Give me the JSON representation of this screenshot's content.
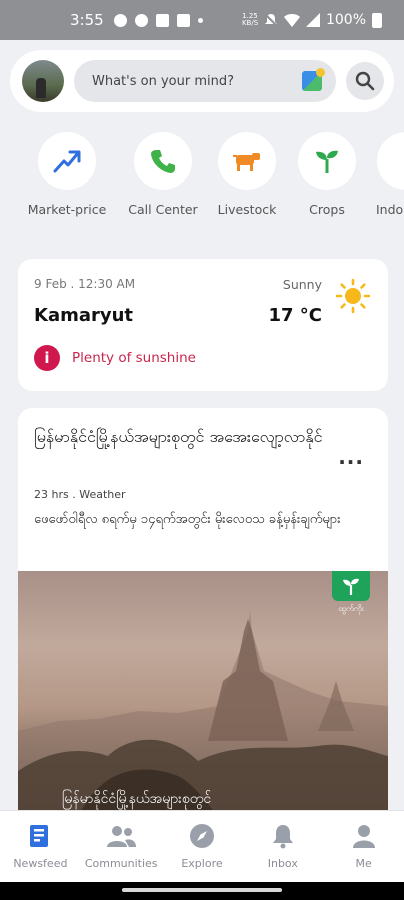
{
  "status_bar": {
    "time": "3:55",
    "network_speed": "1.25 KB/S",
    "battery": "100%"
  },
  "composer": {
    "placeholder": "What's on your mind?"
  },
  "categories": [
    {
      "label": "Market-price",
      "icon": "trend-up-icon"
    },
    {
      "label": "Call Center",
      "icon": "phone-icon"
    },
    {
      "label": "Livestock",
      "icon": "cow-icon"
    },
    {
      "label": "Crops",
      "icon": "sprout-icon"
    },
    {
      "label": "Indo",
      "icon": "indoor-icon"
    }
  ],
  "weather": {
    "date_time": "9 Feb . 12:30 AM",
    "condition": "Sunny",
    "location": "Kamaryut",
    "temperature": "17 °C",
    "alert": "Plenty of sunshine",
    "alert_color": "#c8264c"
  },
  "post": {
    "title": "မြန်မာနိုင်ငံမြို့နယ်အများစုတွင် အအေးလျော့လာနိုင်",
    "time": "23 hrs",
    "category": "Weather",
    "excerpt": "ဖေဖော်ဝါရီလ ၈ရက်မှ ၁၄ရက်အတွင်း မိုးလေဝသ ခန့်မှန်းချက်များ",
    "image_caption": "မြန်မာနိုင်ငံမြို့နယ်အများစုတွင်",
    "logo_text": "ထွက်ကိုး"
  },
  "bottom_nav": [
    {
      "label": "Newsfeed",
      "icon": "newsfeed-icon",
      "active": true
    },
    {
      "label": "Communities",
      "icon": "communities-icon",
      "active": false
    },
    {
      "label": "Explore",
      "icon": "compass-icon",
      "active": false
    },
    {
      "label": "Inbox",
      "icon": "bell-icon",
      "active": false
    },
    {
      "label": "Me",
      "icon": "person-icon",
      "active": false
    }
  ],
  "colors": {
    "accent_blue": "#2f6fde",
    "alert_red": "#d1184e",
    "brand_green": "#1fa25a"
  }
}
